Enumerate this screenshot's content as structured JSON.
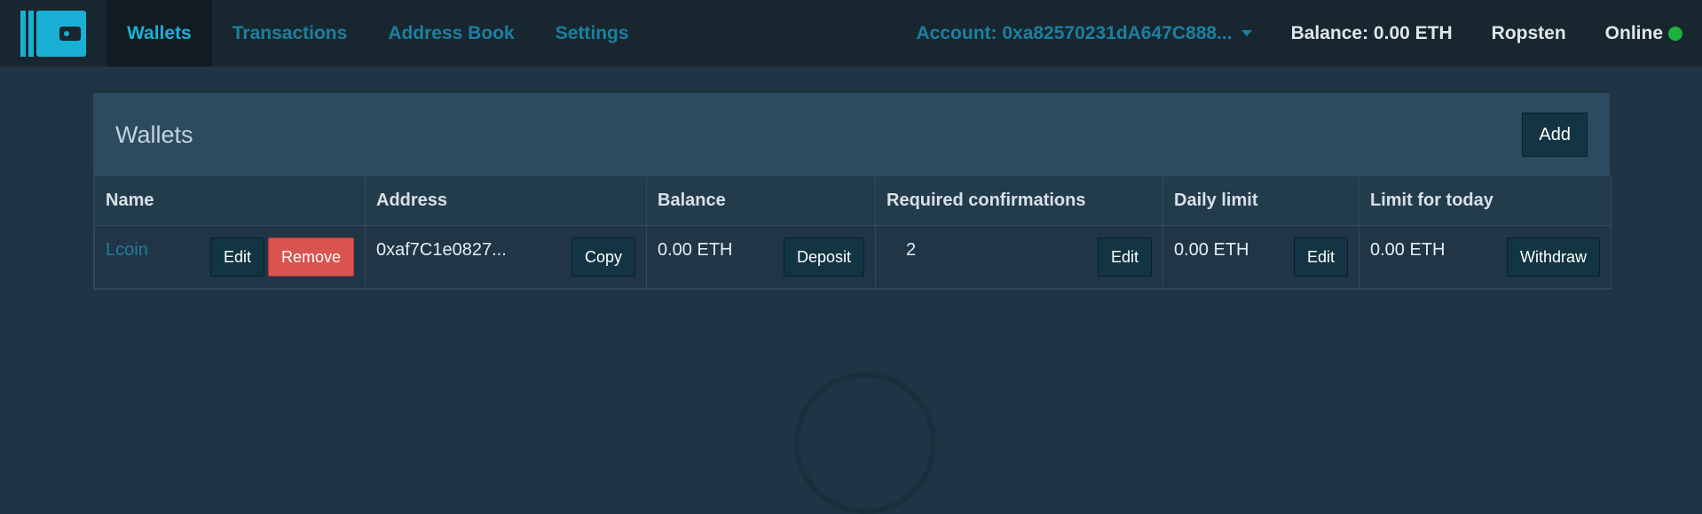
{
  "nav": {
    "logo_icon": "wallet-icon",
    "items": [
      {
        "label": "Wallets",
        "active": true
      },
      {
        "label": "Transactions",
        "active": false
      },
      {
        "label": "Address Book",
        "active": false
      },
      {
        "label": "Settings",
        "active": false
      }
    ],
    "account": "Account: 0xa82570231dA647C888...",
    "balance": "Balance: 0.00 ETH",
    "network": "Ropsten",
    "status": "Online",
    "status_color": "#1ab33d"
  },
  "panel": {
    "title": "Wallets",
    "add_label": "Add"
  },
  "table": {
    "headers": [
      "Name",
      "Address",
      "Balance",
      "Required confirmations",
      "Daily limit",
      "Limit for today"
    ],
    "rows": [
      {
        "name": "Lcoin",
        "edit_label": "Edit",
        "remove_label": "Remove",
        "address": "0xaf7C1e0827...",
        "copy_label": "Copy",
        "balance": "0.00 ETH",
        "deposit_label": "Deposit",
        "confirmations": "2",
        "conf_edit_label": "Edit",
        "daily_limit": "0.00 ETH",
        "limit_edit_label": "Edit",
        "limit_today": "0.00 ETH",
        "withdraw_label": "Withdraw"
      }
    ]
  },
  "colors": {
    "accent": "#1ab0d6",
    "link": "#1d7fa0",
    "danger": "#d9534f",
    "background": "#1f3444"
  }
}
